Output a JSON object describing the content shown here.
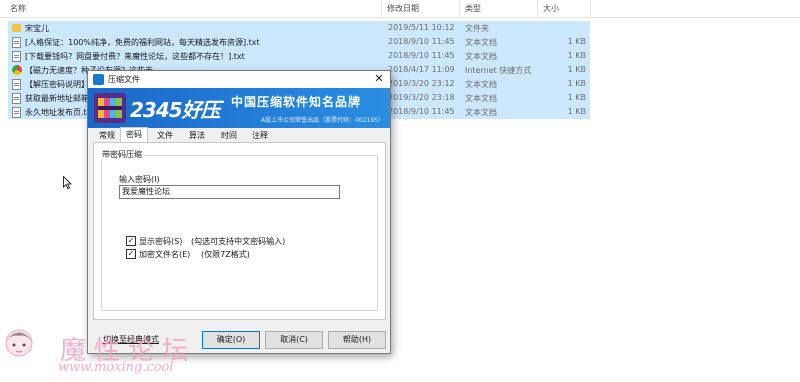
{
  "columns": {
    "name": "名称",
    "date": "修改日期",
    "type": "类型",
    "size": "大小"
  },
  "files": [
    {
      "icon": "folder-icon",
      "name": "宋宝儿",
      "date": "2019/5/11 10:12",
      "type": "文件夹",
      "size": ""
    },
    {
      "icon": "text-file-icon",
      "name": "[人格保证：100%纯净，免费的福利网站，每天精选发布资源].txt",
      "date": "2018/9/10 11:45",
      "type": "文本文档",
      "size": "1 KB"
    },
    {
      "icon": "text-file-icon",
      "name": "[下载要钱吗？网盘要付费？来魔性论坛，这些都不存在！].txt",
      "date": "2018/9/10 11:45",
      "type": "文本文档",
      "size": "1 KB"
    },
    {
      "icon": "internet-shortcut-icon",
      "name": "【磁力无速度？种子没有源？这些天...",
      "date": "2018/4/17 11:09",
      "type": "Internet 快捷方式",
      "size": "1 KB"
    },
    {
      "icon": "text-file-icon",
      "name": "【解压密码说明】",
      "date": "2019/3/20 23:12",
      "type": "文本文档",
      "size": "1 KB"
    },
    {
      "icon": "text-file-icon",
      "name": "获取最新地址邮箱",
      "date": "2019/3/20 23:18",
      "type": "文本文档",
      "size": "1 KB"
    },
    {
      "icon": "text-file-icon",
      "name": "永久地址发布页.txt",
      "date": "2018/9/10 11:45",
      "type": "文本文档",
      "size": "1 KB"
    }
  ],
  "dialog": {
    "title": "压缩文件",
    "close_glyph": "✕",
    "banner_brand": "2345好压",
    "banner_slogan": "中国压缩软件知名品牌",
    "banner_sub": "A股上市公司荣誉出品（股票代码：002195）",
    "tabs": [
      "常规",
      "密码",
      "文件",
      "算法",
      "时间",
      "注释"
    ],
    "group_title": "带密码压缩",
    "password_label": "输入密码(I)",
    "password_value": "我爱魔性论坛",
    "show_password": {
      "checked": true,
      "label": "显示密码(S)",
      "hint": "(勾选可支持中文密码输入)"
    },
    "encrypt_names": {
      "checked": true,
      "label": "加密文件名(E)",
      "hint": "(仅限7Z格式)"
    },
    "buttons": {
      "simple_mode": "切换至经典模式",
      "ok": "确定(O)",
      "cancel": "取消(C)",
      "help": "帮助(H)"
    }
  },
  "watermark": {
    "text": "魔性论坛",
    "url": "www.moxing.cool"
  },
  "colors": {
    "selection": "#cce8ff",
    "banner": "#1a68c9",
    "watermark": "#f2a3c4"
  }
}
